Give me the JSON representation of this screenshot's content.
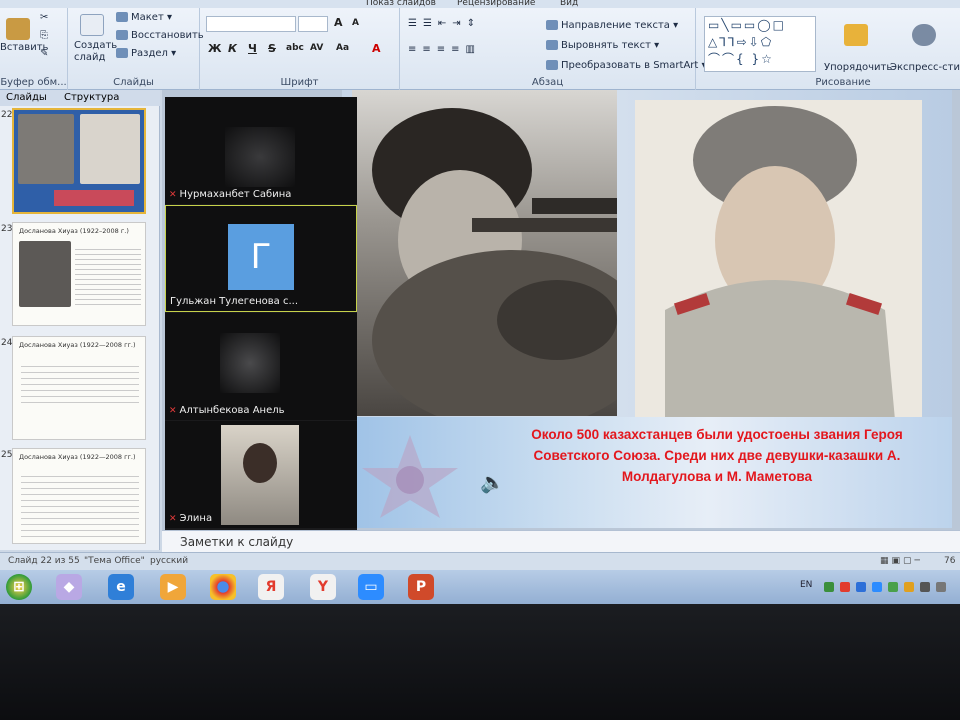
{
  "ribbon": {
    "tabs": [
      "Показ слайдов",
      "Рецензирование",
      "Вид"
    ],
    "clipboard": {
      "paste": "Вставить",
      "label": "Буфер обм..."
    },
    "slides": {
      "new_slide": "Создать слайд",
      "layout": "Макет",
      "reset": "Восстановить",
      "section": "Раздел",
      "label": "Слайды"
    },
    "font": {
      "label": "Шрифт",
      "bold": "Ж",
      "italic": "К",
      "underline": "Ч",
      "strike": "S",
      "shadow": "abc",
      "spacing": "AV",
      "case": "Aa",
      "grow": "A",
      "shrink": "A"
    },
    "paragraph": {
      "direction": "Направление текста",
      "align": "Выровнять текст",
      "smartart": "Преобразовать в SmartArt",
      "label": "Абзац"
    },
    "drawing": {
      "arrange": "Упорядочить",
      "quick_styles": "Экспресс-стили",
      "label": "Рисование"
    }
  },
  "panel": {
    "tabs": [
      "Слайды",
      "Структура"
    ],
    "thumbs": [
      {
        "num": "22",
        "title": ""
      },
      {
        "num": "23",
        "title": "Досланова Хиуаз (1922–2008 г.)"
      },
      {
        "num": "24",
        "title": "Досланова Хиуаз (1922—2008 гг.)"
      },
      {
        "num": "25",
        "title": "Досланова Хиуаз (1922—2008 гг.)"
      }
    ]
  },
  "gallery": {
    "participants": [
      {
        "name": "Нурмаханбет Сабина",
        "muted": true
      },
      {
        "name": "Гульжан Тулегенова с...",
        "muted": false,
        "avatar_letter": "Г"
      },
      {
        "name": "Алтынбекова Анель",
        "muted": true
      },
      {
        "name": "Элина",
        "muted": true
      }
    ]
  },
  "slide": {
    "caption": "Около 500 казахстанцев были удостоены звания Героя Советского Союза. Среди них две девушки-казашки А. Молдагулова и М. Маметова"
  },
  "notes": {
    "placeholder": "Заметки к слайду"
  },
  "status": {
    "slide_counter": "Слайд 22 из 55",
    "theme": "\"Тема Office\"",
    "language": "русский",
    "zoom": "76"
  },
  "taskbar": {
    "yandex": "Я",
    "yandex_browser": "Y"
  },
  "tray": {
    "lang": "EN"
  },
  "colors": {
    "caption": "#e3171d",
    "ribbon": "#dbe5f1",
    "taskbar": "#93afd3",
    "avatar": "#5a9ee0"
  }
}
